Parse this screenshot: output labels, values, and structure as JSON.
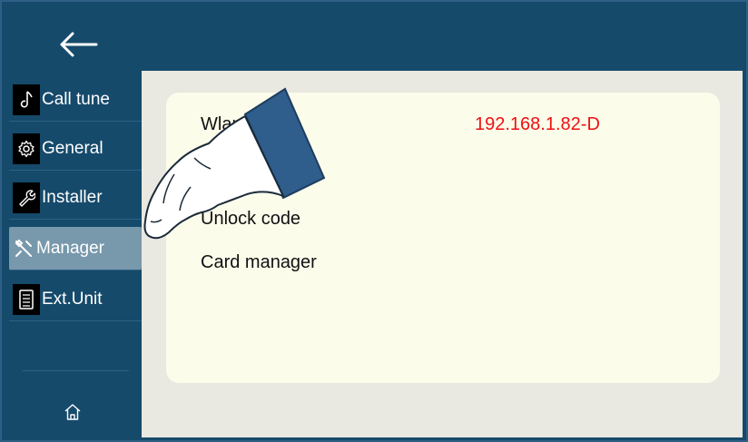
{
  "header": {
    "back_icon": "arrow-left-icon"
  },
  "sidebar": {
    "items": [
      {
        "label": "Call tune",
        "icon": "music-note-icon"
      },
      {
        "label": "General",
        "icon": "gear-icon"
      },
      {
        "label": "Installer",
        "icon": "wrench-icon"
      },
      {
        "label": "Manager",
        "icon": "tools-icon",
        "active": true
      },
      {
        "label": "Ext.Unit",
        "icon": "document-list-icon"
      }
    ],
    "home_icon": "home-icon"
  },
  "settings": {
    "rows": [
      {
        "label": "Wlan setting",
        "value": "192.168.1.82-D"
      },
      {
        "label": "Unlock code"
      },
      {
        "label": "Card manager"
      }
    ]
  },
  "colors": {
    "header_bg": "#164a6b",
    "active_item_bg": "#7898ac",
    "card_bg": "#fcfceb",
    "ip_text": "#ee1111"
  },
  "overlay": {
    "icon": "pointing-hand-icon"
  }
}
